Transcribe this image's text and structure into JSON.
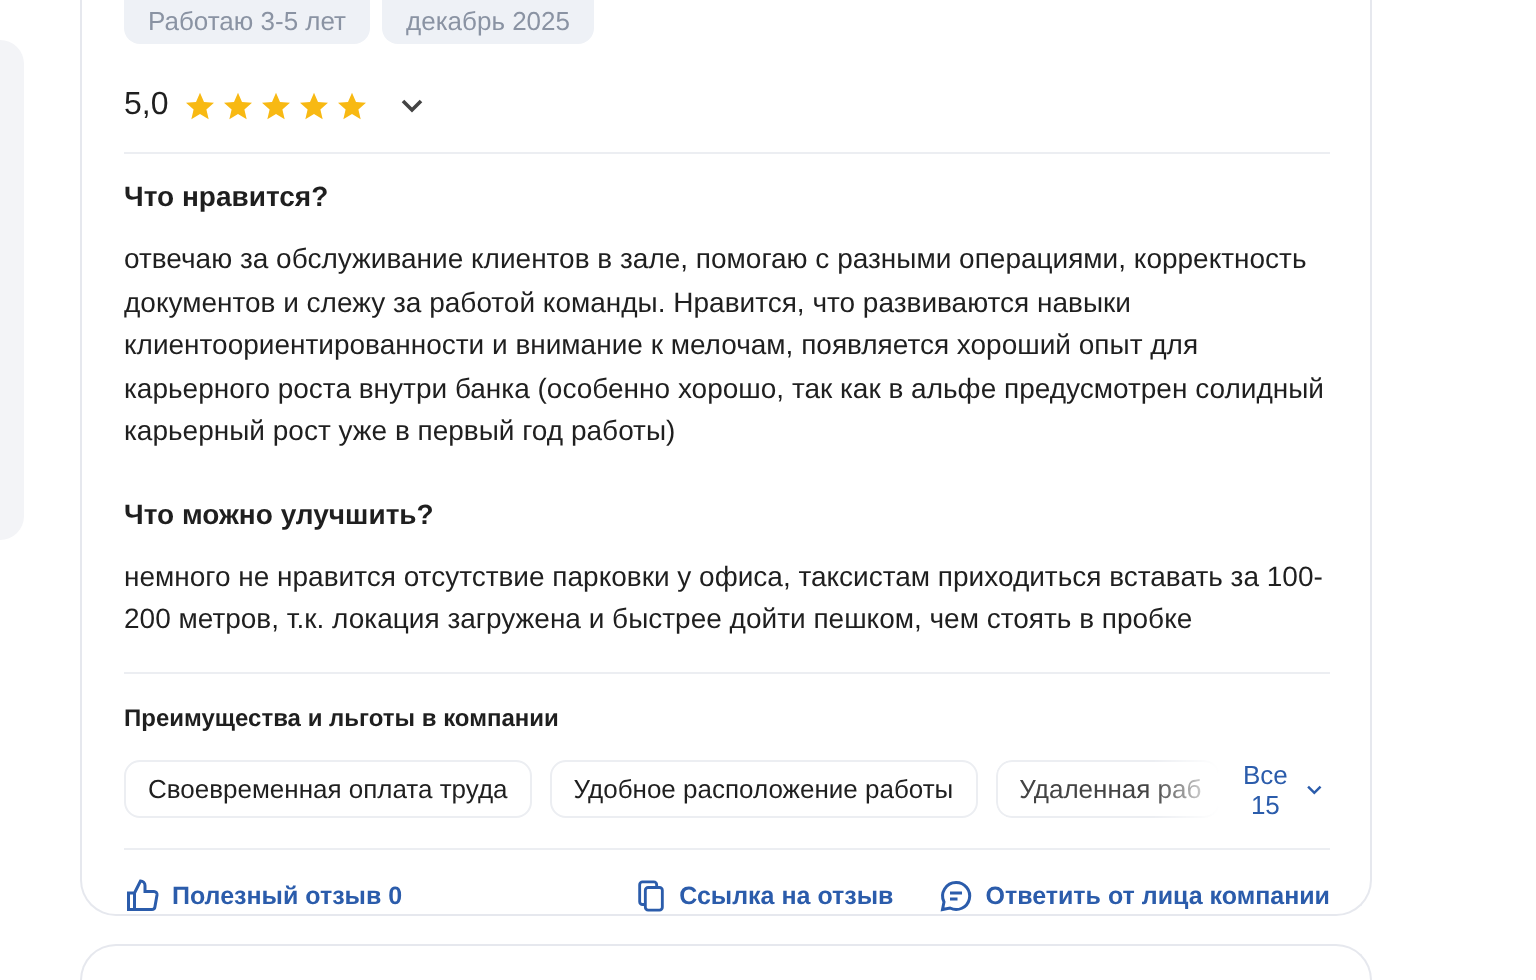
{
  "review": {
    "tags": [
      "Работаю 3-5 лет",
      "декабрь 2025"
    ],
    "rating": {
      "score": "5,0",
      "stars": 5
    },
    "sections": [
      {
        "title": "Что нравится?",
        "text": "отвечаю за обслуживание клиентов в зале, помогаю с разными операциями, корректность документов и слежу за работой команды. Нравится, что развиваются навыки клиентоориентированности и внимание к мелочам, появляется хороший опыт для карьерного роста внутри банка (особенно хорошо, так как в альфе предусмотрен солидный карьерный рост уже в первый год работы)"
      },
      {
        "title": "Что можно улучшить?",
        "text": "немного не нравится отсутствие парковки у офиса, таксистам приходиться вставать за 100-200 метров, т.к. локация загружена и быстрее дойти пешком, чем стоять в пробке"
      }
    ],
    "benefits": {
      "title": "Преимущества и льготы в компании",
      "items": [
        "Своевременная оплата труда",
        "Удобное расположение работы",
        "Удаленная раб"
      ],
      "more": "Все 15"
    },
    "actions": {
      "helpful": "Полезный отзыв 0",
      "link": "Ссылка на отзыв",
      "reply": "Ответить от лица компании"
    }
  }
}
